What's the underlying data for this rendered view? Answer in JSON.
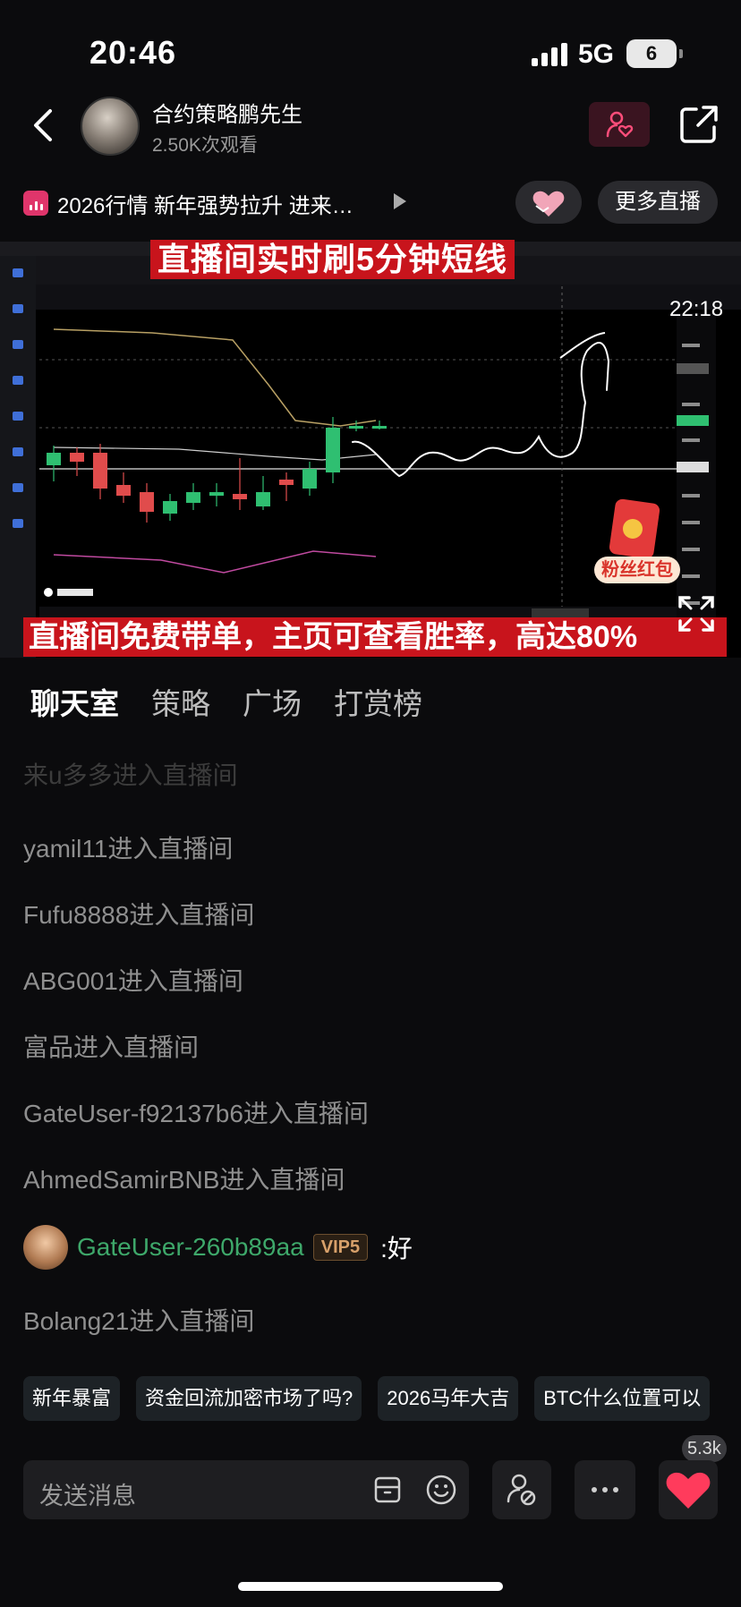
{
  "status_bar": {
    "time": "20:46",
    "network": "5G",
    "battery": "6"
  },
  "header": {
    "streamer_name": "合约策略鹏先生",
    "viewers": "2.50K次观看"
  },
  "ticker": {
    "title": "2026行情 新年强势拉升 进来…",
    "more_live": "更多直播"
  },
  "video": {
    "banner_top": "直播间实时刷5分钟短线",
    "banner_bottom": "直播间免费带单，主页可查看胜率，高达80%",
    "redpack_label": "粉丝红包",
    "timer": "22:18"
  },
  "tabs": [
    "聊天室",
    "策略",
    "广场",
    "打赏榜"
  ],
  "chat": {
    "faded_line": "来u多多进入直播间",
    "lines": [
      "yamil11进入直播间",
      "Fufu8888进入直播间",
      "ABG001进入直播间",
      "富品进入直播间",
      "GateUser-f92137b6进入直播间",
      "AhmedSamirBNB进入直播间"
    ],
    "message": {
      "user": "GateUser-260b89aa",
      "vip": "VIP5",
      "text": ":好"
    },
    "last_line": "Bolang21进入直播间"
  },
  "quick_replies": [
    "新年暴富",
    "资金回流加密市场了吗?",
    "2026马年大吉",
    "BTC什么位置可以"
  ],
  "input": {
    "placeholder": "发送消息"
  },
  "like_count": "5.3k",
  "colors": {
    "accent_red": "#c8141c",
    "green_user": "#3ea86a",
    "like_heart": "#ff3b5c",
    "follow_pink": "#ff4d7a"
  }
}
